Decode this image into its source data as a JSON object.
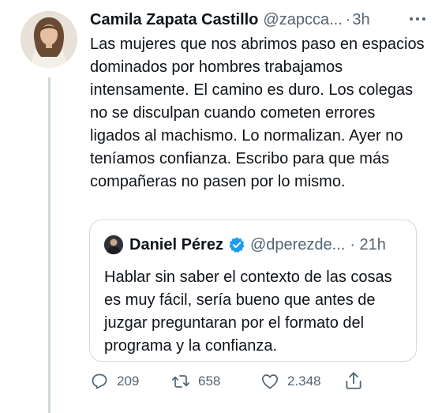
{
  "tweet": {
    "author": {
      "name": "Camila Zapata Castillo",
      "handle": "@zapcca...",
      "separator": "·",
      "time": "3h"
    },
    "text": "Las mujeres que nos abrimos paso en espacios dominados por hombres trabajamos intensamente. El camino es duro. Los colegas no se disculpan cuando cometen errores ligados al machismo. Lo normalizan. Ayer no teníamos confianza. Escribo para que más compañeras no pasen por lo mismo.",
    "quoted": {
      "name": "Daniel Pérez",
      "handle": "@dperezde...",
      "time": "· 21h",
      "verified": true,
      "text": "Hablar sin saber el contexto de las cosas es muy fácil, sería bueno que antes de juzgar preguntaran por el formato del programa y la confianza."
    },
    "actions": {
      "replies": "209",
      "retweets": "658",
      "likes": "2.348"
    }
  },
  "icons": {
    "more": "more-horizontal-icon",
    "verified": "verified-badge-icon",
    "reply": "reply-icon",
    "retweet": "retweet-icon",
    "like": "heart-icon",
    "share": "share-icon"
  },
  "colors": {
    "text": "#0f1419",
    "secondary": "#536471",
    "border": "#cfd9de",
    "verified": "#1d9bf0"
  }
}
